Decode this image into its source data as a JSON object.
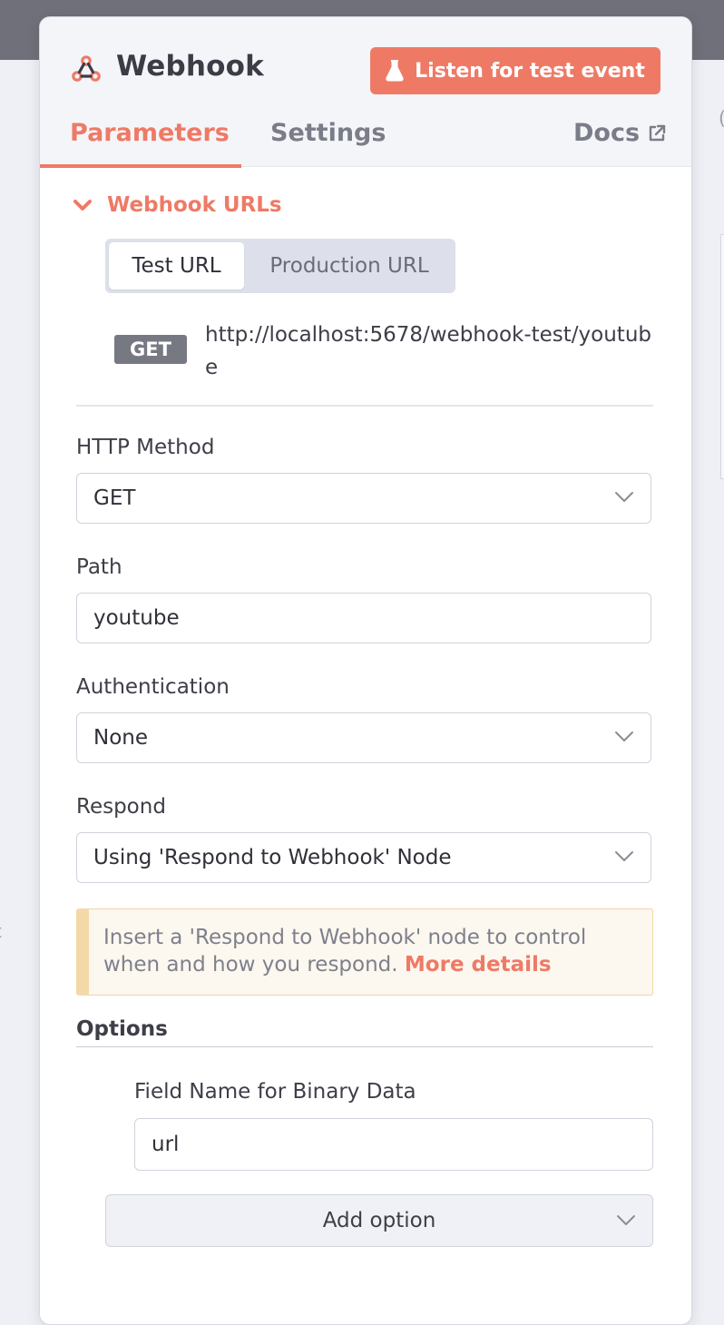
{
  "node": {
    "title": "Webhook",
    "listen_button": "Listen for test event",
    "icon": "webhook-icon",
    "accent_color": "#ee7a66"
  },
  "tabs": [
    {
      "label": "Parameters",
      "active": true
    },
    {
      "label": "Settings",
      "active": false
    },
    {
      "label": "Docs",
      "active": false,
      "icon": "external-link-icon"
    }
  ],
  "webhook_urls": {
    "section_label": "Webhook URLs",
    "expanded": true,
    "url_tabs": [
      "Test URL",
      "Production URL"
    ],
    "active_url_tab": "Test URL",
    "method": "GET",
    "url": "http://localhost:5678/webhook-test/youtube"
  },
  "fields": {
    "http_method": {
      "label": "HTTP Method",
      "value": "GET"
    },
    "path": {
      "label": "Path",
      "value": "youtube"
    },
    "authentication": {
      "label": "Authentication",
      "value": "None"
    },
    "respond": {
      "label": "Respond",
      "value": "Using 'Respond to Webhook' Node"
    }
  },
  "notice": {
    "text": "Insert a 'Respond to Webhook' node to control when and how you respond.",
    "link": "More details"
  },
  "options": {
    "heading": "Options",
    "field_label": "Field Name for Binary Data",
    "field_value": "url",
    "add_button": "Add option"
  }
}
